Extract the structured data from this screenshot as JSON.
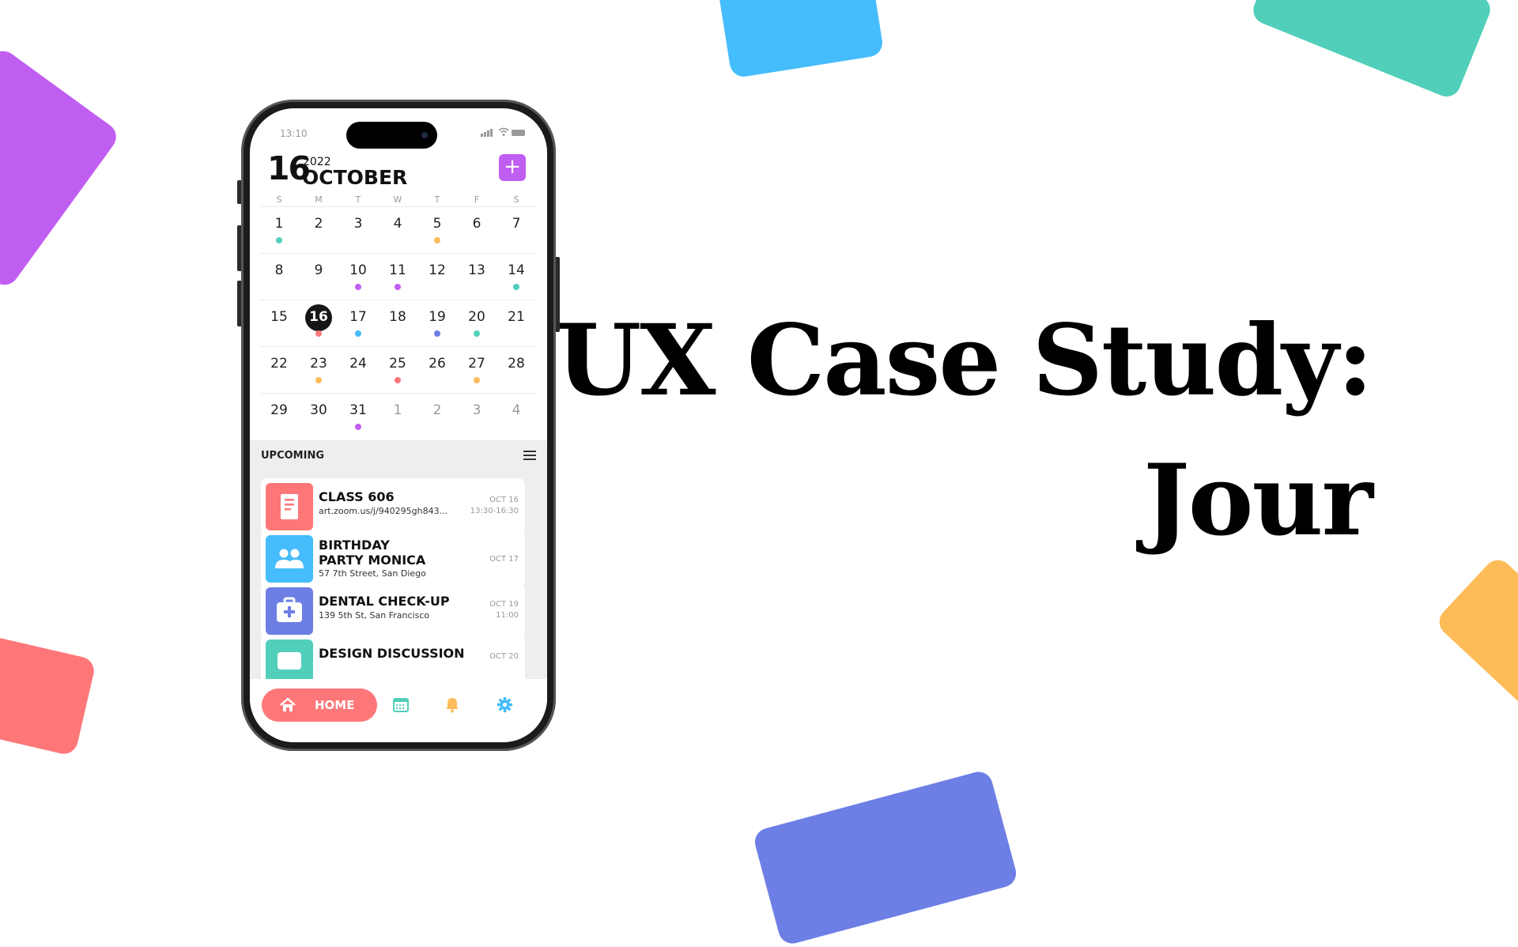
{
  "headline": {
    "line1": "UX Case Study:",
    "line2": "Jour"
  },
  "colors": {
    "purple": "#c15ef2",
    "blue": "#45bcfb",
    "teal": "#52cfbb",
    "red": "#fd7779",
    "indigo": "#6d7ee5",
    "orange": "#fdbc58"
  },
  "phone": {
    "status_time": "13:10",
    "header": {
      "day": "16",
      "year": "2022",
      "month": "OCTOBER",
      "add_icon": "plus-icon"
    },
    "weekdays": [
      "S",
      "M",
      "T",
      "W",
      "T",
      "F",
      "S"
    ],
    "weeks": [
      [
        {
          "d": "1",
          "dot": "teal"
        },
        {
          "d": "2"
        },
        {
          "d": "3"
        },
        {
          "d": "4"
        },
        {
          "d": "5",
          "dot": "orange"
        },
        {
          "d": "6"
        },
        {
          "d": "7"
        }
      ],
      [
        {
          "d": "8"
        },
        {
          "d": "9"
        },
        {
          "d": "10",
          "dot": "purple"
        },
        {
          "d": "11",
          "dot": "purple"
        },
        {
          "d": "12"
        },
        {
          "d": "13"
        },
        {
          "d": "14",
          "dot": "teal"
        }
      ],
      [
        {
          "d": "15"
        },
        {
          "d": "16",
          "dot": "red",
          "today": true
        },
        {
          "d": "17",
          "dot": "blue"
        },
        {
          "d": "18"
        },
        {
          "d": "19",
          "dot": "indigo"
        },
        {
          "d": "20",
          "dot": "teal"
        },
        {
          "d": "21"
        }
      ],
      [
        {
          "d": "22"
        },
        {
          "d": "23",
          "dot": "orange"
        },
        {
          "d": "24"
        },
        {
          "d": "25",
          "dot": "red"
        },
        {
          "d": "26"
        },
        {
          "d": "27",
          "dot": "orange"
        },
        {
          "d": "28"
        }
      ],
      [
        {
          "d": "29"
        },
        {
          "d": "30"
        },
        {
          "d": "31",
          "dot": "purple"
        },
        {
          "d": "1",
          "muted": true
        },
        {
          "d": "2",
          "muted": true
        },
        {
          "d": "3",
          "muted": true
        },
        {
          "d": "4",
          "muted": true
        }
      ]
    ],
    "upcoming": {
      "title": "UPCOMING",
      "filter_icon": "sliders-icon",
      "events": [
        {
          "title": "CLASS 606",
          "subtitle": "art.zoom.us/j/940295gh843...",
          "date": "OCT 16",
          "time": "13:30-16:30",
          "color": "#fd7779",
          "icon": "book-icon"
        },
        {
          "title": "BIRTHDAY PARTY MONICA",
          "subtitle": "57 7th Street, San Diego",
          "date": "OCT 17",
          "time": "",
          "color": "#45bcfb",
          "icon": "people-icon"
        },
        {
          "title": "DENTAL CHECK-UP",
          "subtitle": "139 5th St, San Francisco",
          "date": "OCT 19",
          "time": "11:00",
          "color": "#6d7ee5",
          "icon": "medical-kit-icon"
        },
        {
          "title": "DESIGN DISCUSSION",
          "subtitle": "",
          "date": "OCT 20",
          "time": "",
          "color": "#52cfbb",
          "icon": "chat-icon"
        }
      ]
    },
    "tabbar": {
      "home_label": "HOME",
      "home_icon": "home-icon",
      "calendar_icon": "calendar-icon",
      "bell_icon": "bell-icon",
      "gear_icon": "gear-icon"
    }
  }
}
